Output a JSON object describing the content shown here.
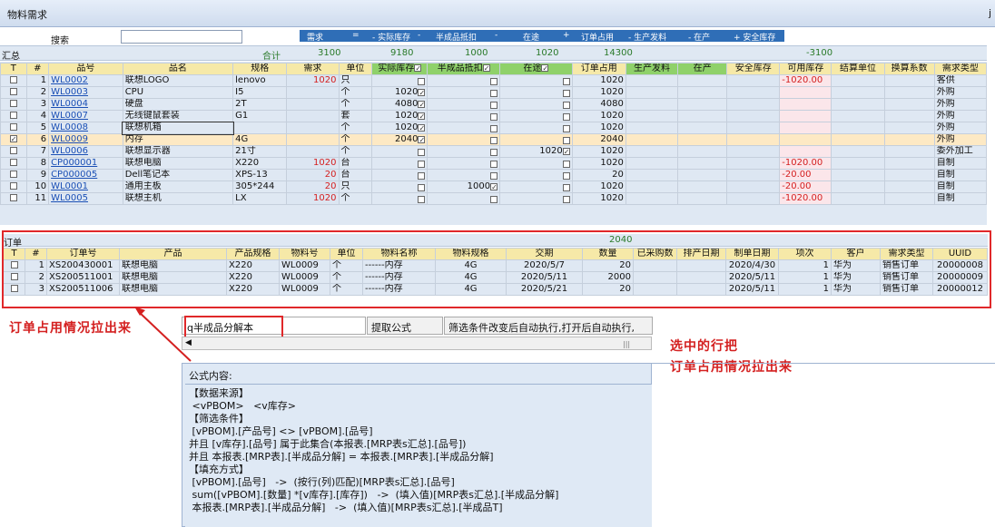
{
  "window": {
    "title": "物料需求",
    "right_glyph": "j"
  },
  "search": {
    "label": "搜索",
    "value": ""
  },
  "formula_band": {
    "parts": [
      "需求",
      "=",
      "- 实际库存",
      "-",
      "半成品抵扣",
      "-",
      "在途",
      "+",
      "订单占用",
      "- 生产发料",
      "- 在产",
      "+ 安全库存"
    ]
  },
  "summary": {
    "label": "汇总",
    "total_label": "合计",
    "demand": "3100",
    "stock": "9180",
    "semi": "1000",
    "transit": "1020",
    "order": "14300",
    "available": "-3100"
  },
  "main_table": {
    "headers": [
      "T",
      "#",
      "品号",
      "品名",
      "规格",
      "需求",
      "单位",
      "实际库存",
      "半成品抵扣",
      "在途",
      "订单占用",
      "生产发料",
      "在产",
      "安全库存",
      "可用库存",
      "结算单位",
      "换算系数",
      "需求类型"
    ],
    "rows": [
      {
        "no": "1",
        "code": "WL0002",
        "name": "联想LOGO",
        "spec": "lenovo",
        "demand": "1020",
        "unit": "只",
        "stock": "",
        "semi": "",
        "transit": "",
        "order": "1020",
        "avail": "-1020.00",
        "type": "客供",
        "checked": false
      },
      {
        "no": "2",
        "code": "WL0003",
        "name": "CPU",
        "spec": "I5",
        "demand": "",
        "unit": "个",
        "stock": "1020",
        "semi": "",
        "transit": "",
        "order": "1020",
        "avail": "",
        "type": "外购",
        "checked": false
      },
      {
        "no": "3",
        "code": "WL0004",
        "name": "硬盘",
        "spec": "2T",
        "demand": "",
        "unit": "个",
        "stock": "4080",
        "semi": "",
        "transit": "",
        "order": "4080",
        "avail": "",
        "type": "外购",
        "checked": false
      },
      {
        "no": "4",
        "code": "WL0007",
        "name": "无线键鼠套装",
        "spec": "G1",
        "demand": "",
        "unit": "套",
        "stock": "1020",
        "semi": "",
        "transit": "",
        "order": "1020",
        "avail": "",
        "type": "外购",
        "checked": false
      },
      {
        "no": "5",
        "code": "WL0008",
        "name": "联想机箱",
        "spec": "",
        "demand": "",
        "unit": "个",
        "stock": "1020",
        "semi": "",
        "transit": "",
        "order": "1020",
        "avail": "",
        "type": "外购",
        "checked": false
      },
      {
        "no": "6",
        "code": "WL0009",
        "name": "内存",
        "spec": "4G",
        "demand": "",
        "unit": "个",
        "stock": "2040",
        "semi": "",
        "transit": "",
        "order": "2040",
        "avail": "",
        "type": "外购",
        "checked": true
      },
      {
        "no": "7",
        "code": "WL0006",
        "name": "联想显示器",
        "spec": "21寸",
        "demand": "",
        "unit": "个",
        "stock": "",
        "semi": "",
        "transit": "1020",
        "order": "1020",
        "avail": "",
        "type": "委外加工",
        "checked": false
      },
      {
        "no": "8",
        "code": "CP000001",
        "name": "联想电脑",
        "spec": "X220",
        "demand": "1020",
        "unit": "台",
        "stock": "",
        "semi": "",
        "transit": "",
        "order": "1020",
        "avail": "-1020.00",
        "type": "自制",
        "checked": false
      },
      {
        "no": "9",
        "code": "CP000005",
        "name": "Dell笔记本",
        "spec": "XPS-13",
        "demand": "20",
        "unit": "台",
        "stock": "",
        "semi": "",
        "transit": "",
        "order": "20",
        "avail": "-20.00",
        "type": "自制",
        "checked": false
      },
      {
        "no": "10",
        "code": "WL0001",
        "name": "通用主板",
        "spec": "305*244",
        "demand": "20",
        "unit": "只",
        "stock": "",
        "semi": "1000",
        "transit": "",
        "order": "1020",
        "avail": "-20.00",
        "type": "自制",
        "checked": false
      },
      {
        "no": "11",
        "code": "WL0005",
        "name": "联想主机",
        "spec": "LX",
        "demand": "1020",
        "unit": "个",
        "stock": "",
        "semi": "",
        "transit": "",
        "order": "1020",
        "avail": "-1020.00",
        "type": "自制",
        "checked": false
      }
    ]
  },
  "order_section": {
    "tab": "订单",
    "total": "2040",
    "headers": [
      "T",
      "#",
      "订单号",
      "产品",
      "产品规格",
      "物料号",
      "单位",
      "物料名称",
      "物料规格",
      "交期",
      "数量",
      "已采购数",
      "排产日期",
      "制单日期",
      "项次",
      "客户",
      "需求类型",
      "UUID"
    ],
    "rows": [
      {
        "no": "1",
        "order_no": "XS200430001",
        "product": "联想电脑",
        "spec": "X220",
        "mat": "WL0009",
        "unit": "个",
        "mat_name": "------内存",
        "mat_spec": "4G",
        "due": "2020/5/7",
        "qty": "20",
        "bought": "",
        "plan": "",
        "created": "2020/4/30",
        "item": "1",
        "customer": "华为",
        "type": "销售订单",
        "uuid": "20000008"
      },
      {
        "no": "2",
        "order_no": "XS200511001",
        "product": "联想电脑",
        "spec": "X220",
        "mat": "WL0009",
        "unit": "个",
        "mat_name": "------内存",
        "mat_spec": "4G",
        "due": "2020/5/11",
        "qty": "2000",
        "bought": "",
        "plan": "",
        "created": "2020/5/11",
        "item": "1",
        "customer": "华为",
        "type": "销售订单",
        "uuid": "20000009"
      },
      {
        "no": "3",
        "order_no": "XS200511006",
        "product": "联想电脑",
        "spec": "X220",
        "mat": "WL0009",
        "unit": "个",
        "mat_name": "------内存",
        "mat_spec": "4G",
        "due": "2020/5/21",
        "qty": "20",
        "bought": "",
        "plan": "",
        "created": "2020/5/11",
        "item": "1",
        "customer": "华为",
        "type": "销售订单",
        "uuid": "20000012"
      }
    ]
  },
  "annotations": {
    "left": "订单占用情况拉出来",
    "right_line1": "选中的行把",
    "right_line2": "订单占用情况拉出来"
  },
  "formula_panel": {
    "filter_tab": "q半成品分解本",
    "extract_button": "提取公式",
    "auto_exec": "筛选条件改变后自动执行,打开后自动执行,",
    "caption": "公式内容:",
    "lines": [
      "【数据来源】",
      " <vPBOM>   <v库存>",
      "【筛选条件】",
      " [vPBOM].[产品号] <> [vPBOM].[品号]",
      "并且 [v库存].[品号] 属于此集合(本报表.[MRP表s汇总].[品号])",
      "并且 本报表.[MRP表].[半成品分解] = 本报表.[MRP表].[半成品分解]",
      "【填充方式】",
      " [vPBOM].[品号]   ->  (按行(列)匹配)[MRP表s汇总].[品号]",
      " sum([vPBOM].[数量] *[v库存].[库存])   ->  (填入值)[MRP表s汇总].[半成品分解]",
      " 本报表.[MRP表].[半成品分解]   ->  (填入值)[MRP表s汇总].[半成品T]"
    ]
  },
  "colors": {
    "accent_blue": "#2f6eb7",
    "header_yellow": "#f6e9a8",
    "header_green": "#8fd16a",
    "annotation_red": "#d42020",
    "selected_row": "#fde9c4"
  }
}
